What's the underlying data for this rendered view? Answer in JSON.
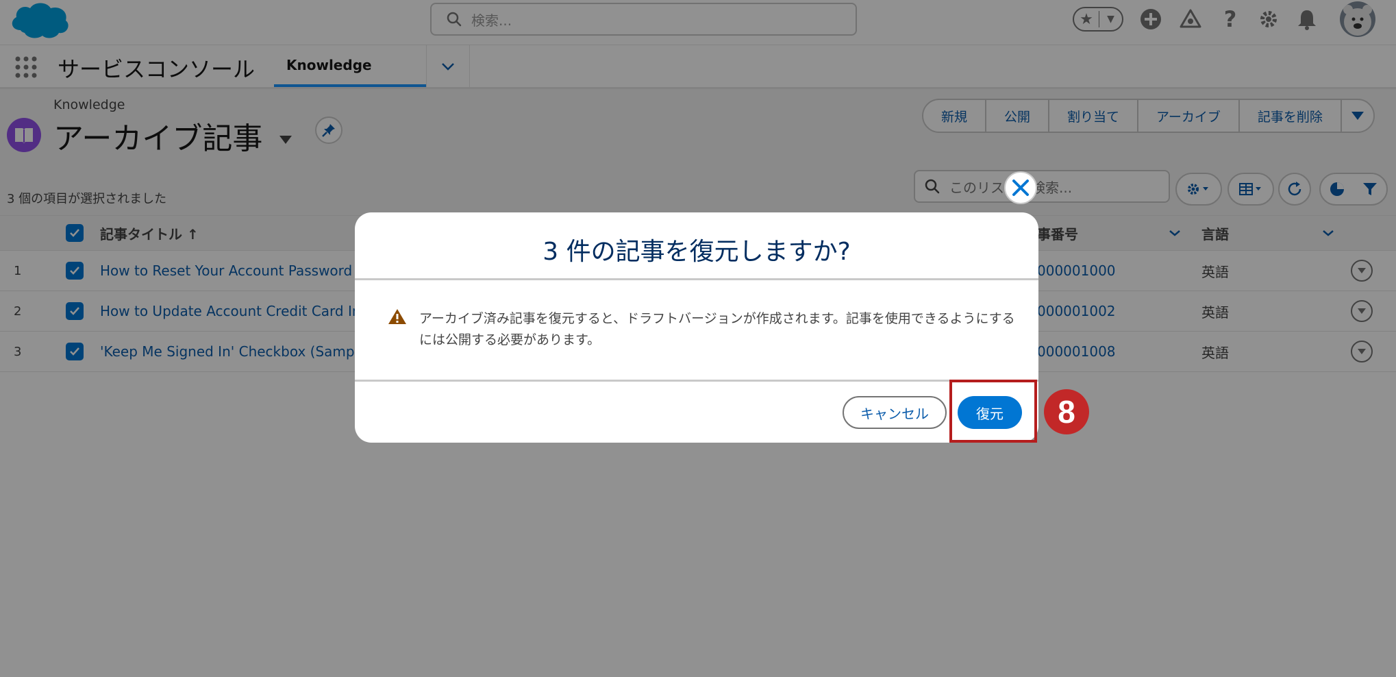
{
  "global_header": {
    "search_placeholder": "検索..."
  },
  "app_nav": {
    "app_name": "サービスコンソール",
    "tab_label": "Knowledge"
  },
  "list_header": {
    "breadcrumb": "Knowledge",
    "title": "アーカイブ記事",
    "actions": [
      "新規",
      "公開",
      "割り当て",
      "アーカイブ",
      "記事を削除"
    ],
    "selected_count": "3 個の項目が選択されました",
    "search_placeholder": "このリストを検索..."
  },
  "table": {
    "columns": {
      "title": "記事タイトル ↑",
      "article_number": "記事番号",
      "language": "言語"
    },
    "rows": [
      {
        "num": "1",
        "title": "How to Reset Your Account Password (",
        "article_number": "000001000",
        "language": "英語"
      },
      {
        "num": "2",
        "title": "How to Update Account Credit Card Inf",
        "article_number": "000001002",
        "language": "英語"
      },
      {
        "num": "3",
        "title": "'Keep Me Signed In' Checkbox (Sample",
        "article_number": "000001008",
        "language": "英語"
      }
    ]
  },
  "modal": {
    "title": "3 件の記事を復元しますか?",
    "message": "アーカイブ済み記事を復元すると、ドラフトバージョンが作成されます。記事を使用できるようにするには公開する必要があります。",
    "cancel_label": "キャンセル",
    "confirm_label": "復元"
  },
  "annotation": {
    "step": "8"
  },
  "colors": {
    "brand": "#0176d3",
    "link": "#0b5cab",
    "highlight": "#b51d1d",
    "object_icon": "#9050e9"
  }
}
